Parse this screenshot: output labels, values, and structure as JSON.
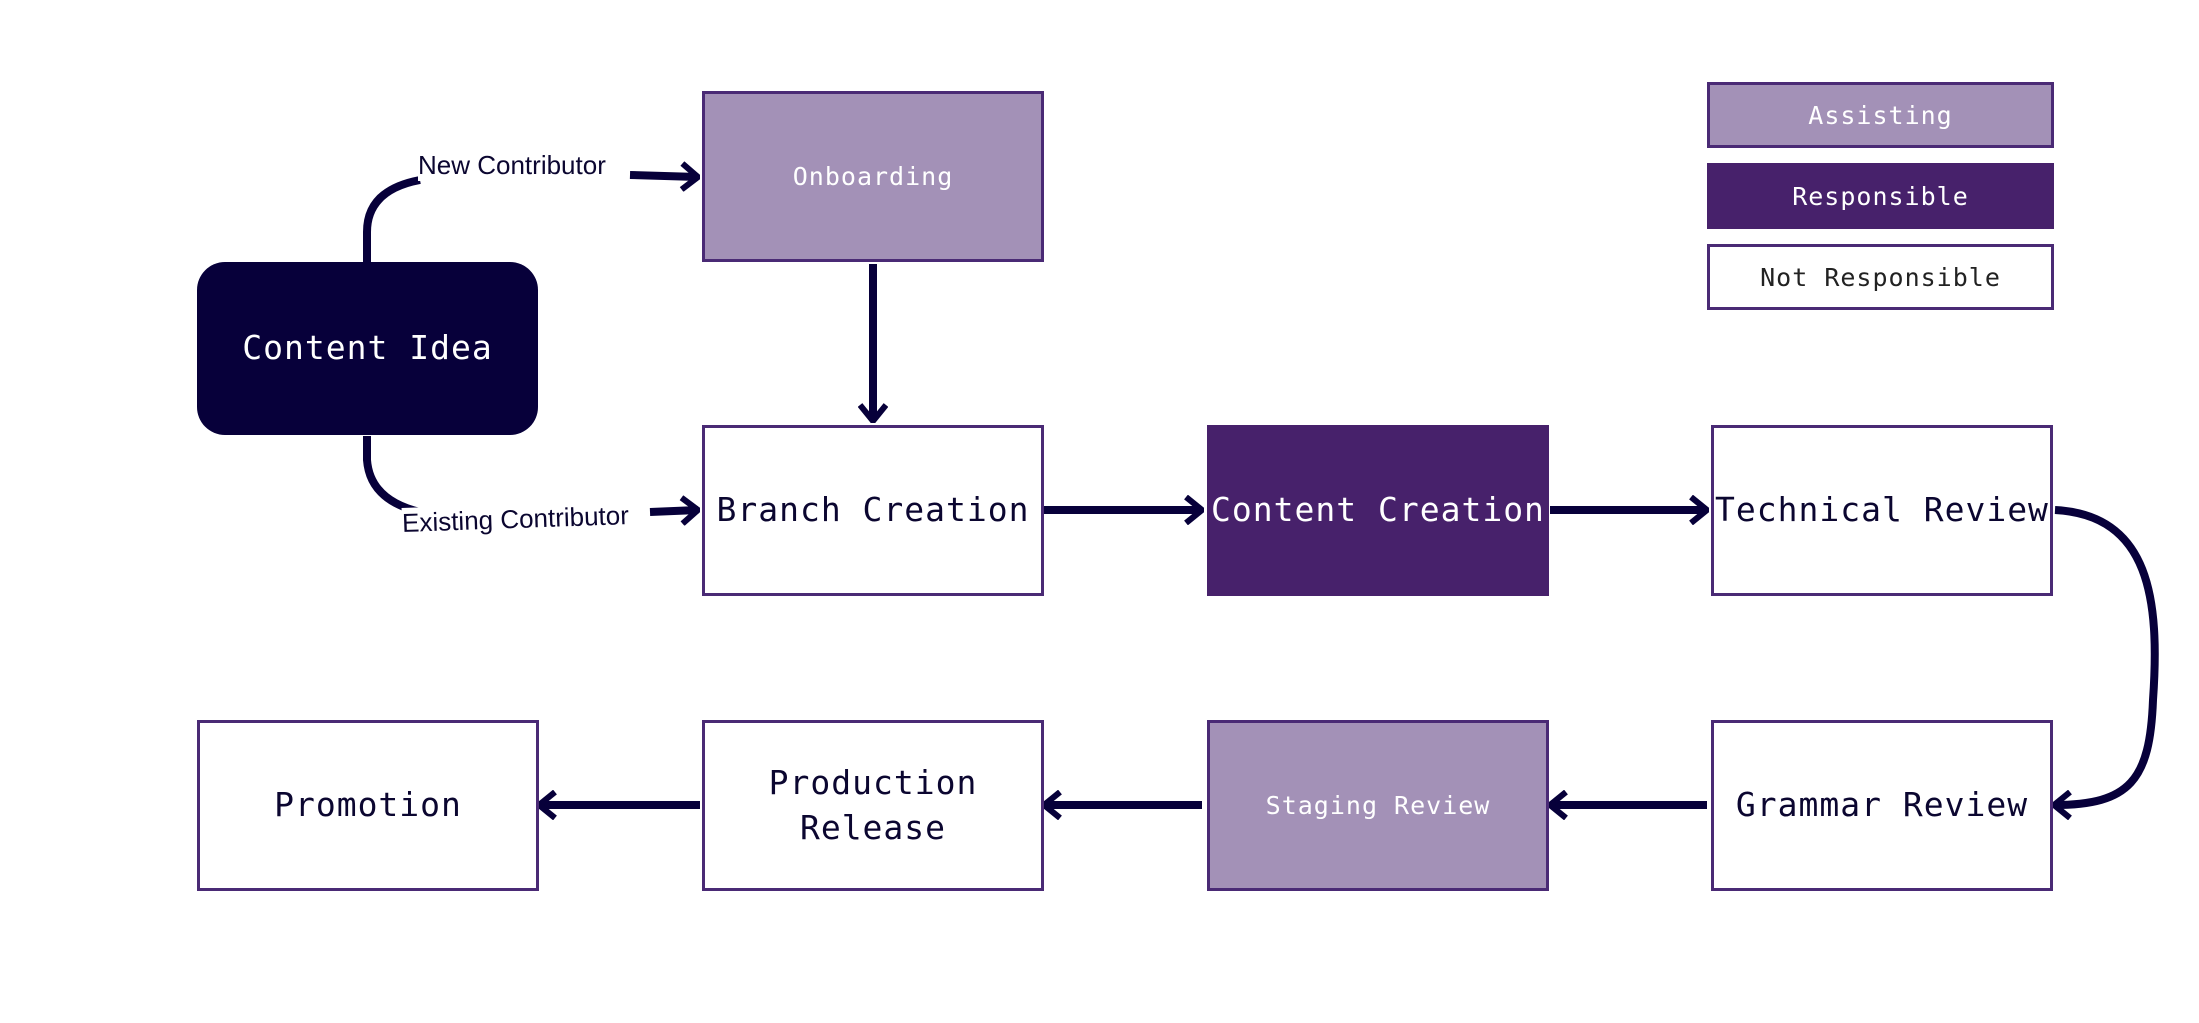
{
  "colors": {
    "start": "#07003a",
    "responsible": "#47216b",
    "assisting": "#a391b7",
    "border": "#4a2a75",
    "edge": "#07003a"
  },
  "legend": [
    {
      "label": "Assisting",
      "role": "assisting"
    },
    {
      "label": "Responsible",
      "role": "responsible"
    },
    {
      "label": "Not Responsible",
      "role": "not-responsible"
    }
  ],
  "nodes": {
    "content_idea": {
      "label": "Content Idea",
      "role": "start"
    },
    "onboarding": {
      "label": "Onboarding",
      "role": "assisting"
    },
    "branch_creation": {
      "label": "Branch Creation",
      "role": "not-responsible"
    },
    "content_creation": {
      "label": "Content Creation",
      "role": "responsible"
    },
    "technical_review": {
      "label": "Technical Review",
      "role": "not-responsible"
    },
    "grammar_review": {
      "label": "Grammar Review",
      "role": "not-responsible"
    },
    "staging_review": {
      "label": "Staging Review",
      "role": "assisting"
    },
    "production_release": {
      "label": "Production\nRelease",
      "role": "not-responsible"
    },
    "promotion": {
      "label": "Promotion",
      "role": "not-responsible"
    }
  },
  "edges": [
    {
      "from": "content_idea",
      "to": "onboarding",
      "label": "New Contributor"
    },
    {
      "from": "content_idea",
      "to": "branch_creation",
      "label": "Existing Contributor"
    },
    {
      "from": "onboarding",
      "to": "branch_creation",
      "label": ""
    },
    {
      "from": "branch_creation",
      "to": "content_creation",
      "label": ""
    },
    {
      "from": "content_creation",
      "to": "technical_review",
      "label": ""
    },
    {
      "from": "technical_review",
      "to": "grammar_review",
      "label": ""
    },
    {
      "from": "grammar_review",
      "to": "staging_review",
      "label": ""
    },
    {
      "from": "staging_review",
      "to": "production_release",
      "label": ""
    },
    {
      "from": "production_release",
      "to": "promotion",
      "label": ""
    }
  ]
}
